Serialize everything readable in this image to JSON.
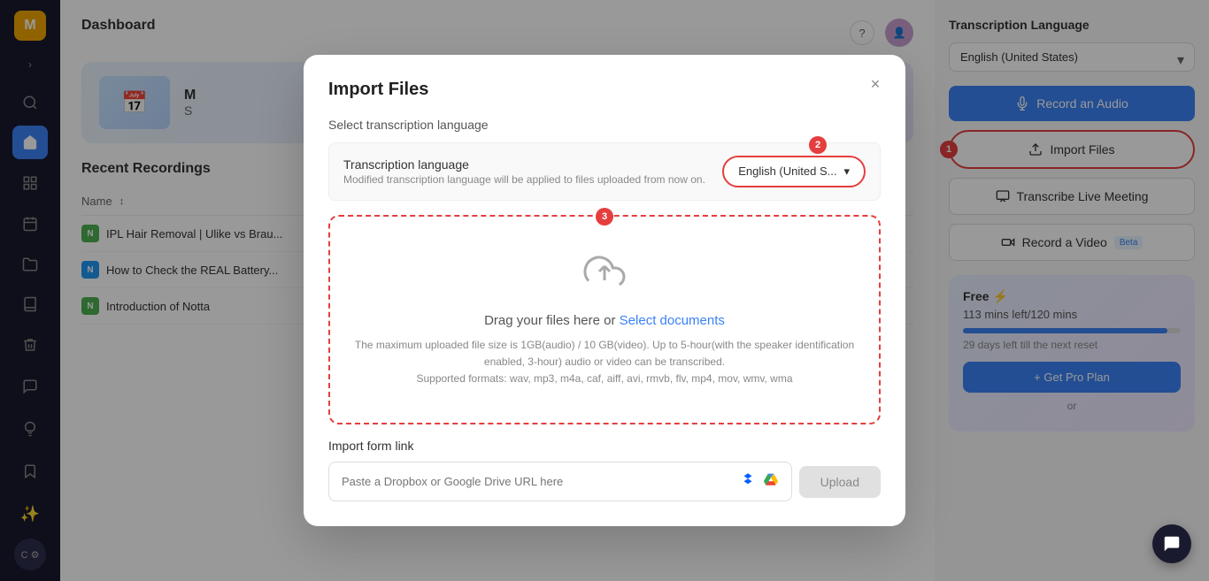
{
  "sidebar": {
    "avatar_letter": "M",
    "items": [
      {
        "id": "search",
        "icon": "🔍",
        "active": false
      },
      {
        "id": "home",
        "icon": "🏠",
        "active": true
      },
      {
        "id": "grid",
        "icon": "⊞",
        "active": false
      },
      {
        "id": "calendar",
        "icon": "📅",
        "active": false
      },
      {
        "id": "folder",
        "icon": "📁",
        "active": false
      },
      {
        "id": "book",
        "icon": "📖",
        "active": false
      },
      {
        "id": "trash",
        "icon": "🗑",
        "active": false
      }
    ],
    "bottom_items": [
      {
        "id": "chat",
        "icon": "💬"
      },
      {
        "id": "bulb",
        "icon": "💡"
      },
      {
        "id": "bookmark",
        "icon": "🔖"
      }
    ],
    "sparkle_icon": "✨",
    "c_label": "C"
  },
  "header": {
    "title": "Dashboard",
    "help_icon": "?",
    "avatar_url": ""
  },
  "hero": {
    "emoji": "📅",
    "initial": "M",
    "subtitle": "S"
  },
  "recent_recordings": {
    "title": "Recent Recordings",
    "column_name": "Name",
    "rows": [
      {
        "title": "IPL Hair Removal | Ulike vs Brau...",
        "icon_color": "green",
        "icon_letter": "N"
      },
      {
        "title": "How to Check the REAL Battery...",
        "icon_color": "blue",
        "icon_letter": "N"
      },
      {
        "title": "Introduction of Notta",
        "icon_color": "green",
        "icon_letter": "N"
      }
    ]
  },
  "right_panel": {
    "transcription_language_label": "Transcription Language",
    "language_value": "English (United States)",
    "btn_record_audio": "Record an Audio",
    "btn_import_files": "Import Files",
    "btn_transcribe_live": "Transcribe Live Meeting",
    "btn_record_video": "Record a Video",
    "beta_badge": "Beta",
    "free_plan": {
      "title": "Free",
      "lightning_icon": "⚡",
      "mins_left": "113 mins left/120 mins",
      "progress_pct": 94,
      "days_left": "29 days left till the next reset",
      "btn_get_pro": "+ Get Pro Plan",
      "or_text": "or"
    }
  },
  "modal": {
    "title": "Import Files",
    "close_icon": "×",
    "section_label": "Select transcription language",
    "lang_row": {
      "title": "Transcription language",
      "subtitle": "Modified transcription language will be applied to files uploaded from now on.",
      "selected_lang": "English (United S...",
      "chevron": "▾",
      "step_badge": "2"
    },
    "upload_zone": {
      "step_badge": "3",
      "icon": "☁",
      "drag_text": "Drag your files here or",
      "select_link": "Select documents",
      "info_line1": "The maximum uploaded file size is 1GB(audio) / 10 GB(video). Up to 5-hour(with the speaker identification",
      "info_line2": "enabled, 3-hour) audio or video can be transcribed.",
      "info_line3": "Supported formats: wav, mp3, m4a, caf, aiff, avi, rmvb, flv, mp4, mov, wmv, wma"
    },
    "import_link": {
      "label": "Import form link",
      "placeholder": "Paste a Dropbox or Google Drive URL here",
      "dropbox_icon": "🔷",
      "gdrive_icon": "🟢",
      "btn_upload": "Upload"
    }
  },
  "chat_button": {
    "icon": "💬"
  }
}
